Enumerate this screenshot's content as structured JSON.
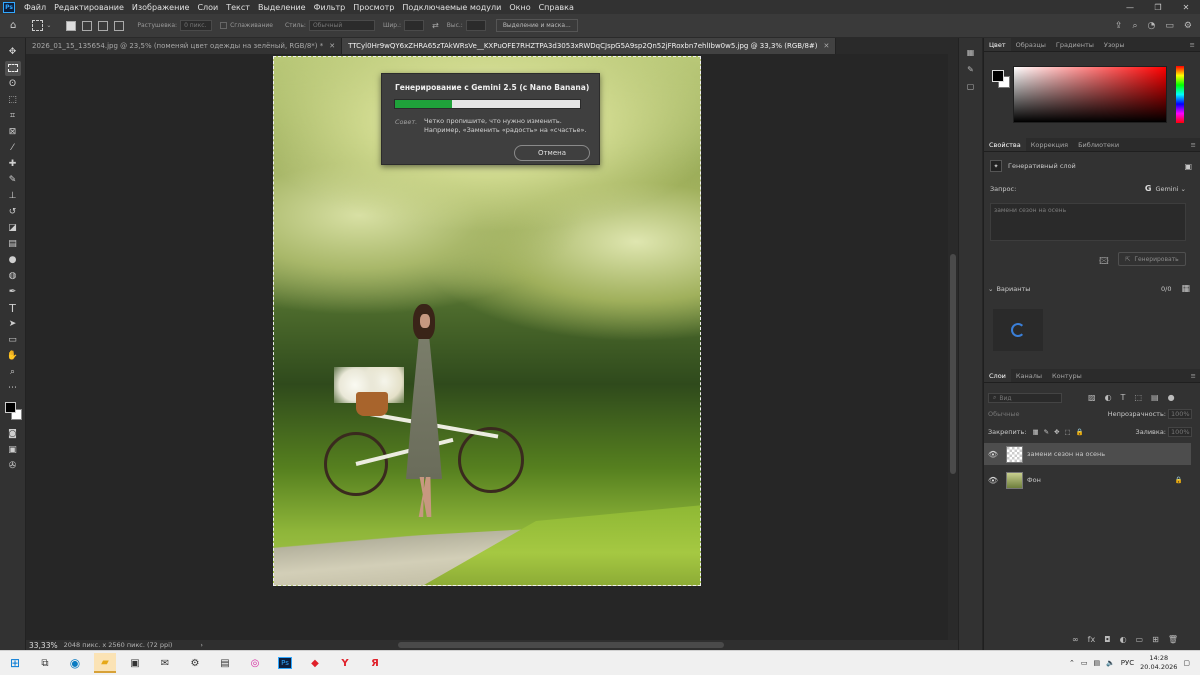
{
  "menu": {
    "app_logo": "Ps",
    "items": [
      "Файл",
      "Редактирование",
      "Изображение",
      "Слои",
      "Текст",
      "Выделение",
      "Фильтр",
      "Просмотр",
      "Подключаемые модули",
      "Окно",
      "Справка"
    ],
    "window_controls": [
      "—",
      "❐",
      "✕"
    ]
  },
  "options_bar": {
    "feather_label": "Растушевка:",
    "feather_value": "0 пикс.",
    "antialias_label": "Сглаживание",
    "style_label": "Стиль:",
    "style_value": "Обычный",
    "width_label": "Шир.:",
    "height_label": "Выс.:",
    "select_mask_button": "Выделение и маска..."
  },
  "doc_tabs": [
    {
      "label": "2026_01_15_135654.jpg @ 23,5% (поменяй цвет одежды на зелёный, RGB/8*) *",
      "close": "✕"
    },
    {
      "label": "TTCyl0Hr9wQY6xZHRA65zTAkWRsVe__KXPuOFE7RHZTPA3d3053xRWDqCJspG5A9sp2Qn52jFRoxbn7ehlIbw0w5.jpg @ 33,3% (RGB/8#)",
      "close": "✕"
    }
  ],
  "gen_dialog": {
    "title": "Генерирование с Gemini 2.5 (с Nano Banana)",
    "progress": 0.31,
    "progress_color": "#1fa23a",
    "tip_label": "Совет.",
    "tip_text": "Четко пропишите, что нужно изменить. Например, «Заменить «радость» на «счастье».",
    "cancel": "Отмена"
  },
  "status": {
    "zoom": "33,33%",
    "doc_size": "2048 пикс. x 2560 пикс. (72 ppi)",
    "chevron": "›"
  },
  "color_panel": {
    "tabs": [
      "Цвет",
      "Образцы",
      "Градиенты",
      "Узоры"
    ],
    "fg": "#000000",
    "bg": "#ffffff"
  },
  "properties_panel": {
    "tabs": [
      "Свойства",
      "Коррекция",
      "Библиотеки"
    ],
    "layer_type": "Генеративный слой",
    "prompt_label": "Запрос:",
    "model": "Gemini",
    "prompt_value": "замени сезон на осень",
    "generate_button": "Генерировать",
    "variants_label": "Варианты",
    "variants_count": "0/0"
  },
  "layers_panel": {
    "tabs": [
      "Слои",
      "Каналы",
      "Контуры"
    ],
    "search_placeholder": "Вид",
    "blend_mode": "Обычные",
    "opacity_label": "Непрозрачность:",
    "opacity_value": "100%",
    "lock_label": "Закрепить:",
    "fill_label": "Заливка:",
    "fill_value": "100%",
    "layers": [
      {
        "name": "замени сезон на осень",
        "selected": true
      },
      {
        "name": "Фон",
        "selected": false
      }
    ]
  },
  "taskbar": {
    "lang": "РУС",
    "time": "14:28",
    "date": "20.04.2026"
  }
}
